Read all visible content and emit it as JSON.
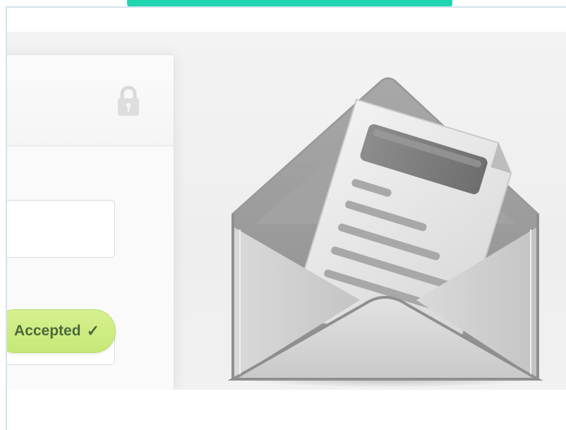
{
  "status_badge": {
    "label": "Accepted",
    "check_glyph": "✓",
    "color": "#c6e877",
    "text_color": "#4b6a3a"
  },
  "icons": {
    "lock": "lock-icon",
    "envelope": "open-envelope-icon",
    "check": "checkmark-icon"
  },
  "colors": {
    "accent_bar": "#1fd6b0",
    "frame_rule": "#d4e3ee",
    "background": "#eeeeee"
  }
}
